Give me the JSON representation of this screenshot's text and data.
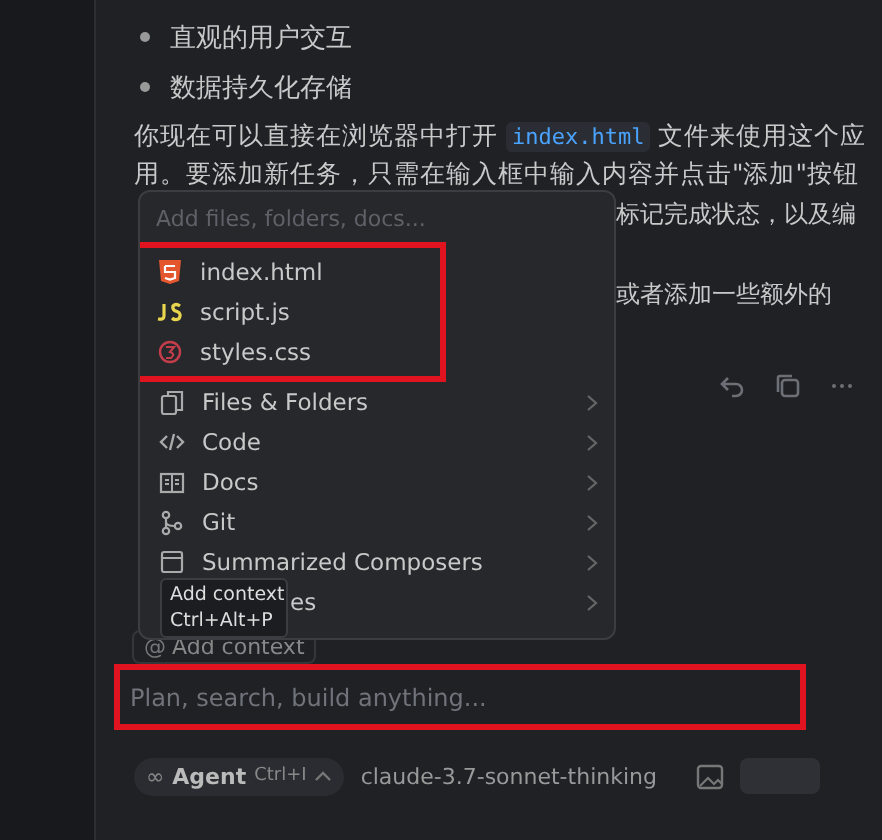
{
  "bullets": [
    "直观的用户交互",
    "数据持久化存储"
  ],
  "paragraph": {
    "before": "你现在可以直接在浏览器中打开",
    "code": "index.html",
    "after": "文件来使用这个应用。要添加新任务，只需在输入框中输入内容并点击\"添加\"按钮"
  },
  "line_fragments": [
    "标记完成状态，以及编",
    "或者添加一些额外的"
  ],
  "context_menu": {
    "placeholder": "Add files, folders, docs...",
    "files": {
      "annotated": true,
      "items": [
        {
          "kind": "html",
          "label": "index.html"
        },
        {
          "kind": "js",
          "label": "script.js"
        },
        {
          "kind": "css",
          "label": "styles.css"
        }
      ]
    },
    "categories": [
      {
        "kind": "folder",
        "label": "Files & Folders"
      },
      {
        "kind": "code",
        "label": "Code"
      },
      {
        "kind": "docs",
        "label": "Docs"
      },
      {
        "kind": "git",
        "label": "Git"
      },
      {
        "kind": "composer",
        "label": "Summarized Composers"
      },
      {
        "kind": "covered",
        "label": "es"
      }
    ]
  },
  "tooltip": {
    "title": "Add context",
    "shortcut": "Ctrl+Alt+P"
  },
  "add_context": {
    "icon": "@",
    "label": "Add context"
  },
  "composer": {
    "placeholder": "Plan, search, build anything...",
    "annotated": true
  },
  "mode": {
    "icon": "∞",
    "label": "Agent",
    "shortcut": "Ctrl+I"
  },
  "model": "claude-3.7-sonnet-thinking"
}
